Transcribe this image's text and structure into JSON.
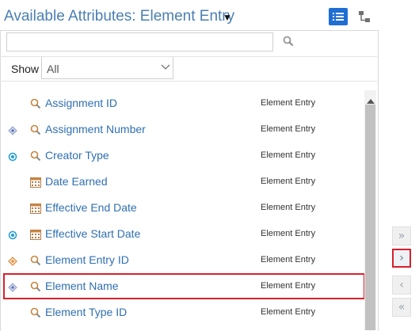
{
  "header": {
    "title": "Available Attributes: Element Entry",
    "dropdown_icon": "caret-down-icon",
    "list_view_icon": "list-view-icon",
    "tree_view_icon": "hierarchy-icon"
  },
  "search": {
    "value": "",
    "placeholder": "",
    "icon": "search-icon"
  },
  "filter": {
    "show_label": "Show",
    "selected": "All"
  },
  "attributes": [
    {
      "name": "Assignment ID",
      "category": "Element Entry",
      "marker": "none",
      "icon": "search-icon",
      "selected": false
    },
    {
      "name": "Assignment Number",
      "category": "Element Entry",
      "marker": "diamond",
      "icon": "search-icon",
      "selected": false
    },
    {
      "name": "Creator Type",
      "category": "Element Entry",
      "marker": "circle",
      "icon": "search-icon",
      "selected": false
    },
    {
      "name": "Date Earned",
      "category": "Element Entry",
      "marker": "none",
      "icon": "calendar-icon",
      "selected": false
    },
    {
      "name": "Effective End Date",
      "category": "Element Entry",
      "marker": "none",
      "icon": "calendar-icon",
      "selected": false
    },
    {
      "name": "Effective Start Date",
      "category": "Element Entry",
      "marker": "circle",
      "icon": "calendar-icon",
      "selected": false
    },
    {
      "name": "Element Entry ID",
      "category": "Element Entry",
      "marker": "orange-diamond",
      "icon": "search-icon",
      "selected": false
    },
    {
      "name": "Element Name",
      "category": "Element Entry",
      "marker": "diamond",
      "icon": "search-icon",
      "selected": true
    },
    {
      "name": "Element Type ID",
      "category": "Element Entry",
      "marker": "none",
      "icon": "search-icon",
      "selected": false
    }
  ],
  "shuttle": {
    "move_all": "»",
    "move_selected": "›",
    "remove_selected": "‹",
    "remove_all": "«"
  },
  "colors": {
    "title": "#4a7fb3",
    "link": "#2f6fb2",
    "accent": "#1f6ed4",
    "highlight_border": "#d9202e"
  }
}
